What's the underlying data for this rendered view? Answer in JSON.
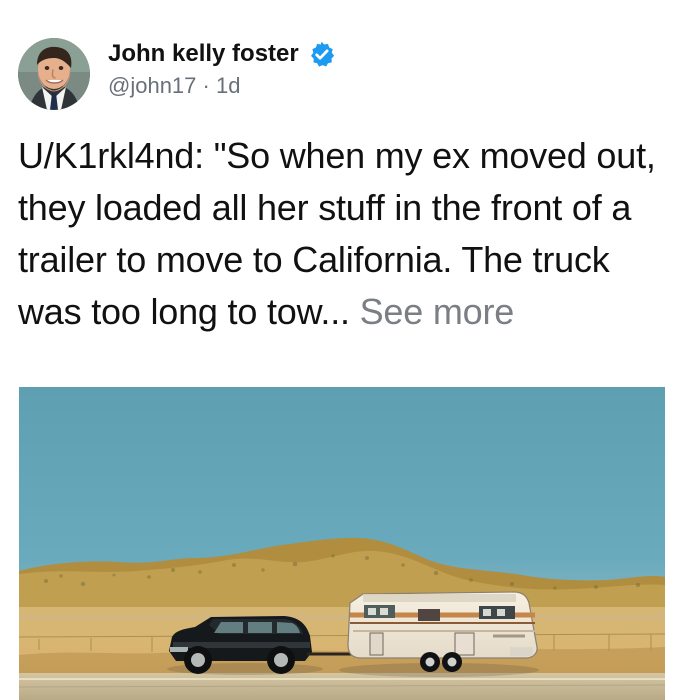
{
  "post": {
    "author": {
      "display_name": "John kelly foster",
      "handle": "@john17",
      "timestamp": "1d",
      "separator": "·",
      "avatar_icon": "profile-photo-avatar",
      "verified_icon": "verified-badge-icon",
      "verified_color": "#1d9bf0"
    },
    "text": "U/K1rkl4nd: \"So when my ex moved out, they loaded all her stuff in the front of a trailer to move to California. The truck was too long to tow...",
    "see_more": "See more",
    "image": {
      "description_icon": "trailer-and-suv-desert-photo",
      "sky_color": "#69a9bb",
      "hill_color": "#b69242",
      "ground_color": "#d4b26f"
    }
  }
}
